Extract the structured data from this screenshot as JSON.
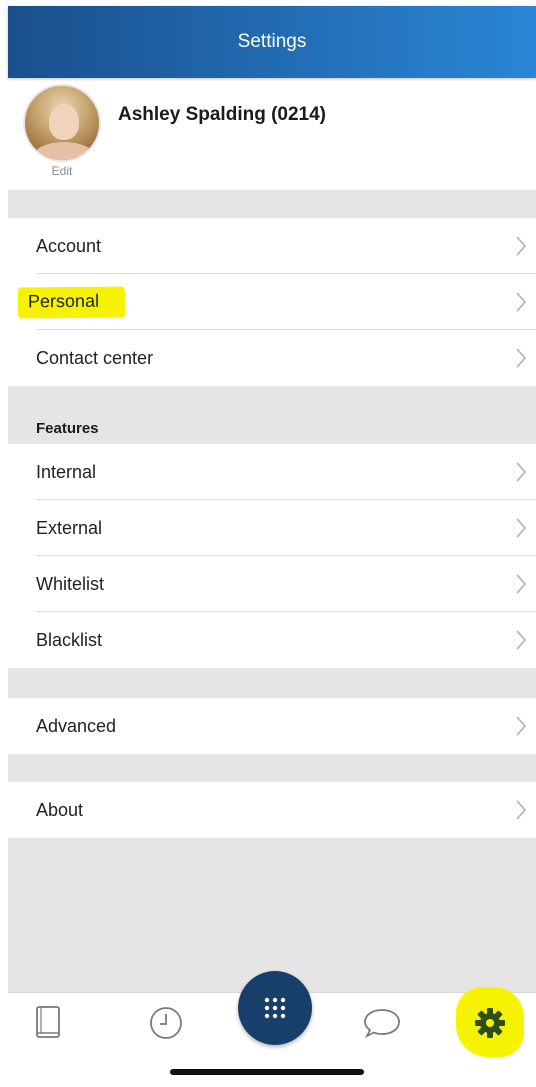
{
  "header": {
    "title": "Settings"
  },
  "profile": {
    "name": "Ashley Spalding (0214)",
    "edit_label": "Edit"
  },
  "groups": [
    {
      "items": [
        {
          "label": "Account"
        },
        {
          "label": "Personal",
          "highlighted": true
        },
        {
          "label": "Contact center"
        }
      ]
    },
    {
      "header": "Features",
      "items": [
        {
          "label": "Internal"
        },
        {
          "label": "External"
        },
        {
          "label": "Whitelist"
        },
        {
          "label": "Blacklist"
        }
      ]
    },
    {
      "items": [
        {
          "label": "Advanced"
        }
      ]
    },
    {
      "items": [
        {
          "label": "About"
        }
      ]
    }
  ],
  "tabbar": {
    "tabs": [
      {
        "icon": "contacts-book-icon"
      },
      {
        "icon": "clock-history-icon"
      },
      {
        "icon": "dialpad-icon"
      },
      {
        "icon": "chat-bubble-icon"
      },
      {
        "icon": "gear-icon",
        "active": true,
        "highlighted": true
      }
    ]
  },
  "colors": {
    "header_gradient_start": "#1a4f8c",
    "header_gradient_end": "#2a86d6",
    "fab": "#173f6a",
    "highlight": "#f7f300",
    "section_gap": "#e5e5e5",
    "active_tab_icon": "#2f4f1a"
  }
}
